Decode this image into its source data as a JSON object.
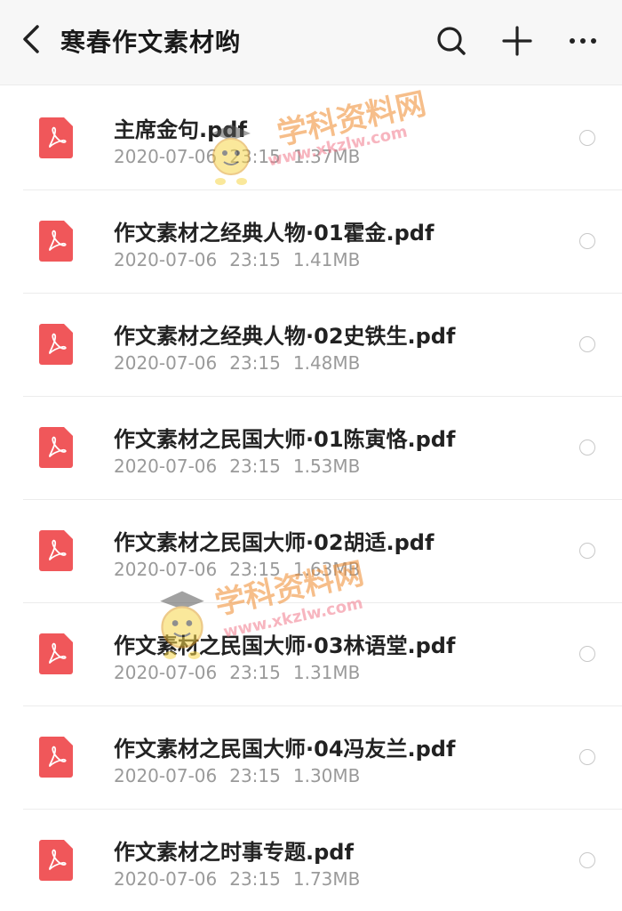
{
  "header": {
    "title": "寒春作文素材哟",
    "icons": [
      "back-icon",
      "search-icon",
      "plus-icon",
      "more-icon"
    ]
  },
  "files": [
    {
      "name": "主席金句.pdf",
      "date": "2020-07-06",
      "time": "23:15",
      "size": "1.37MB"
    },
    {
      "name": "作文素材之经典人物·01霍金.pdf",
      "date": "2020-07-06",
      "time": "23:15",
      "size": "1.41MB"
    },
    {
      "name": "作文素材之经典人物·02史铁生.pdf",
      "date": "2020-07-06",
      "time": "23:15",
      "size": "1.48MB"
    },
    {
      "name": "作文素材之民国大师·01陈寅恪.pdf",
      "date": "2020-07-06",
      "time": "23:15",
      "size": "1.53MB"
    },
    {
      "name": "作文素材之民国大师·02胡适.pdf",
      "date": "2020-07-06",
      "time": "23:15",
      "size": "1.63MB"
    },
    {
      "name": "作文素材之民国大师·03林语堂.pdf",
      "date": "2020-07-06",
      "time": "23:15",
      "size": "1.31MB"
    },
    {
      "name": "作文素材之民国大师·04冯友兰.pdf",
      "date": "2020-07-06",
      "time": "23:15",
      "size": "1.30MB"
    },
    {
      "name": "作文素材之时事专题.pdf",
      "date": "2020-07-06",
      "time": "23:15",
      "size": "1.73MB"
    }
  ],
  "watermark": {
    "text": "学科资料网",
    "url": "www.xkzlw.com"
  },
  "colors": {
    "pdf_icon": "#f0575a",
    "watermark_text": "#f08a2c",
    "watermark_url": "#f27a8c"
  }
}
